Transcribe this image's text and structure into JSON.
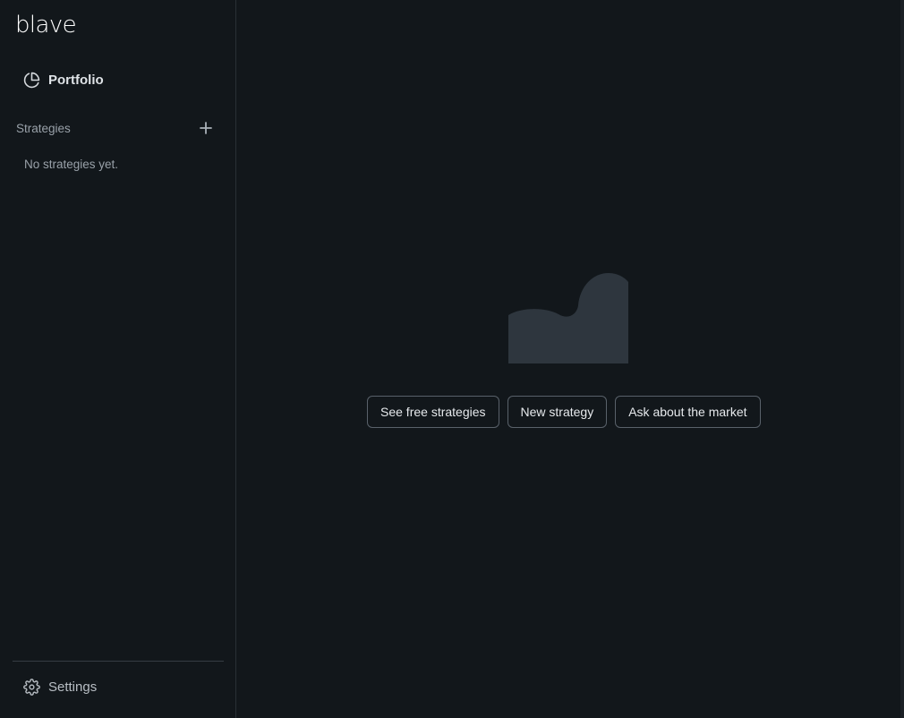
{
  "brand": {
    "logo_text": "blave"
  },
  "sidebar": {
    "nav": {
      "portfolio": {
        "label": "Portfolio",
        "icon": "pie-chart-icon"
      }
    },
    "strategies": {
      "header": "Strategies",
      "add_icon": "plus-icon",
      "empty_text": "No strategies yet."
    },
    "settings": {
      "label": "Settings",
      "icon": "gear-icon"
    }
  },
  "main": {
    "illustration_icon": "empty-state-wave-illustration",
    "actions": [
      {
        "label": "See free strategies"
      },
      {
        "label": "New strategy"
      },
      {
        "label": "Ask about the market"
      }
    ]
  },
  "colors": {
    "background": "#12171b",
    "border": "#2a3036",
    "illustration": "#2e363e",
    "button_border": "#59616a"
  }
}
